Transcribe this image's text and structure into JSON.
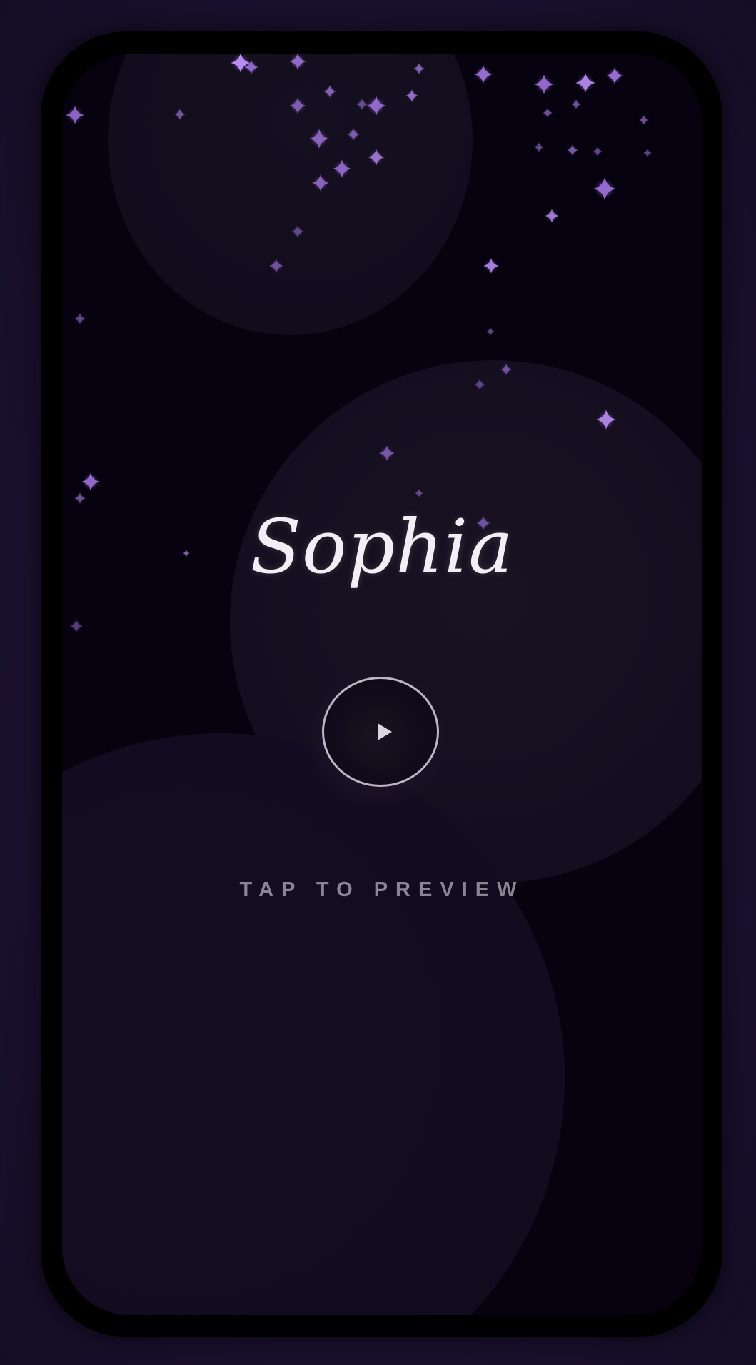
{
  "preview": {
    "title": "Sophia",
    "hint": "TAP TO PREVIEW",
    "play_icon": "play-icon"
  },
  "colors": {
    "background": "#1c1232",
    "screen": "#06020f",
    "sparkle": "#9b6fd6",
    "title_text": "#f3eef6",
    "hint_text": "#8a8494"
  }
}
